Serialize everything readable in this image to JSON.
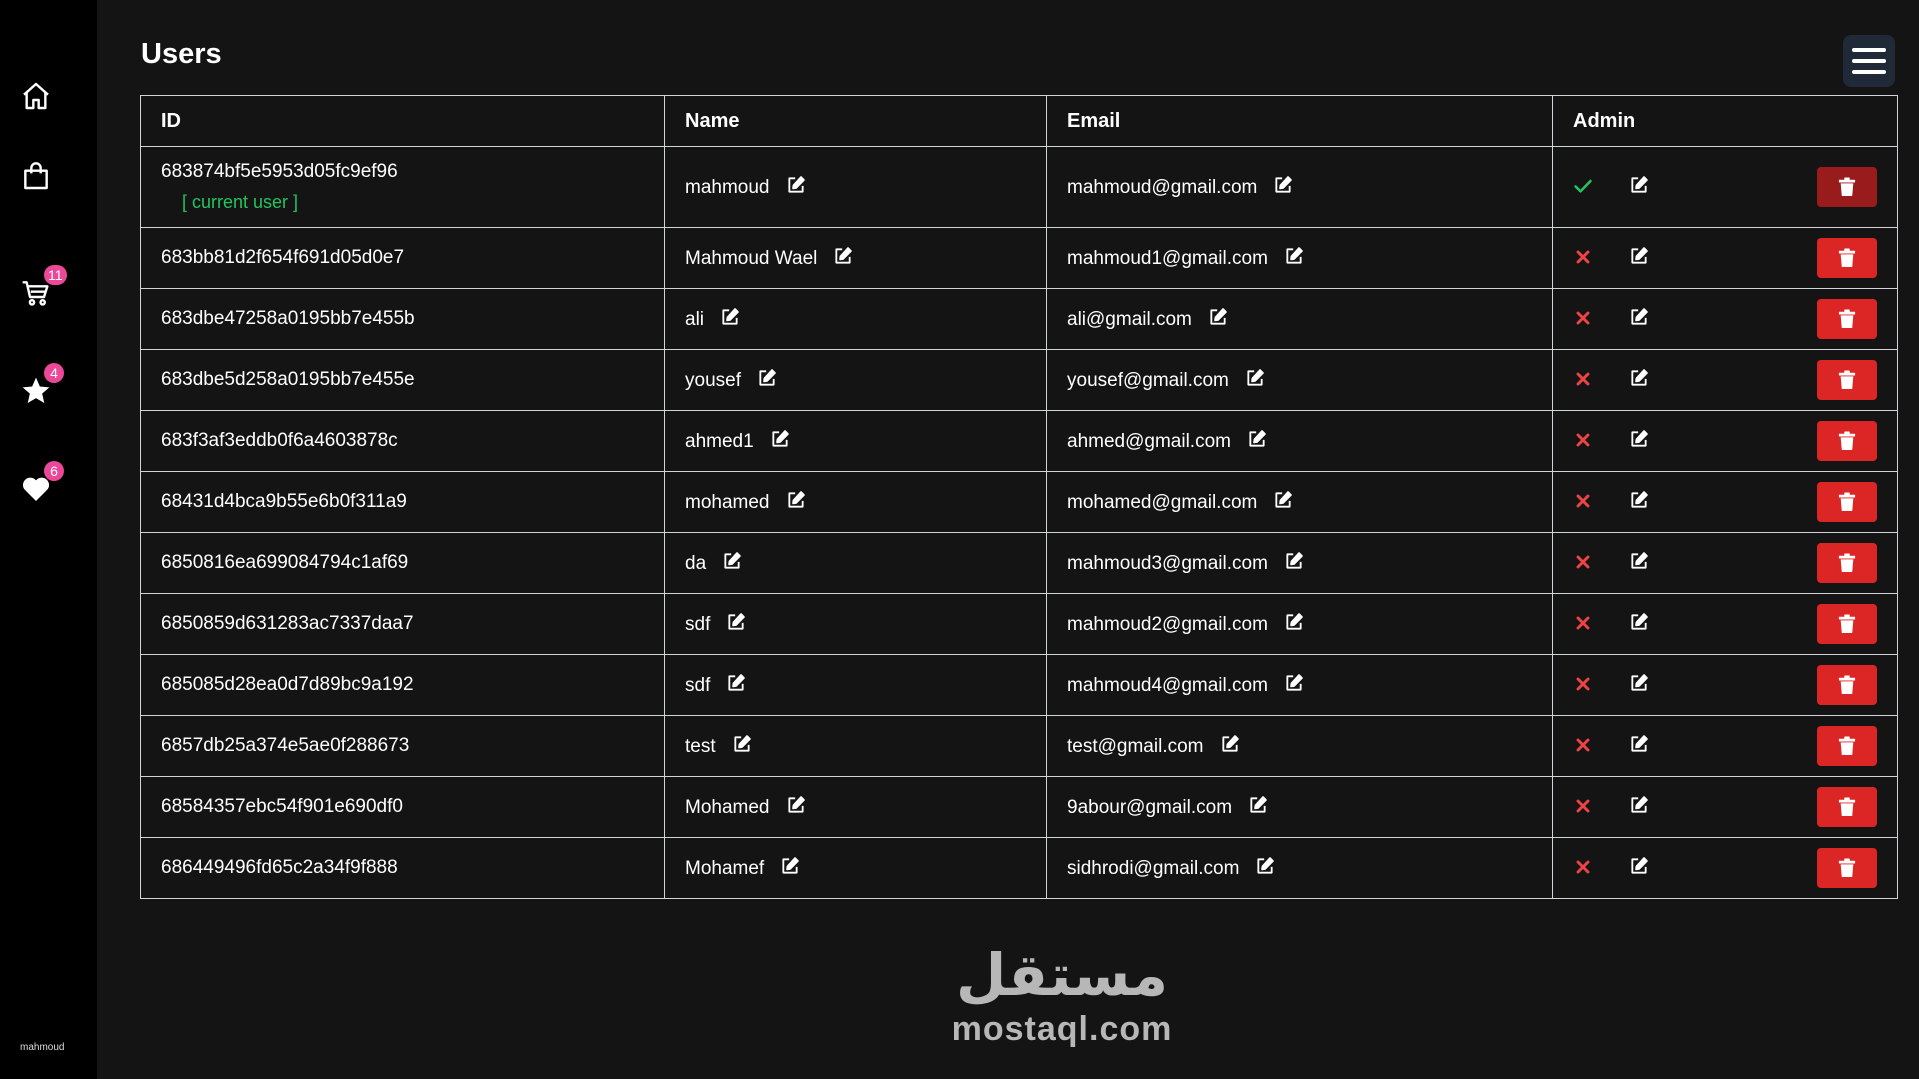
{
  "sidebar": {
    "items": [
      {
        "name": "home",
        "icon": "home-icon"
      },
      {
        "name": "shop",
        "icon": "shopping-bag-icon"
      },
      {
        "name": "cart",
        "icon": "cart-icon",
        "badge": "11"
      },
      {
        "name": "favorites",
        "icon": "star-icon",
        "badge": "4"
      },
      {
        "name": "wishlist",
        "icon": "heart-icon",
        "badge": "6"
      }
    ],
    "user_label": "mahmoud"
  },
  "header": {
    "title": "Users",
    "menu_icon": "hamburger-icon"
  },
  "table": {
    "headers": [
      "ID",
      "Name",
      "Email",
      "Admin"
    ],
    "current_user_label": "[ current user ]",
    "rows": [
      {
        "id": "683874bf5e5953d05fc9ef96",
        "name": "mahmoud",
        "email": "mahmoud@gmail.com",
        "admin": true,
        "current": true
      },
      {
        "id": "683bb81d2f654f691d05d0e7",
        "name": "Mahmoud Wael",
        "email": "mahmoud1@gmail.com",
        "admin": false
      },
      {
        "id": "683dbe47258a0195bb7e455b",
        "name": "ali",
        "email": "ali@gmail.com",
        "admin": false
      },
      {
        "id": "683dbe5d258a0195bb7e455e",
        "name": "yousef",
        "email": "yousef@gmail.com",
        "admin": false
      },
      {
        "id": "683f3af3eddb0f6a4603878c",
        "name": "ahmed1",
        "email": "ahmed@gmail.com",
        "admin": false
      },
      {
        "id": "68431d4bca9b55e6b0f311a9",
        "name": "mohamed",
        "email": "mohamed@gmail.com",
        "admin": false
      },
      {
        "id": "6850816ea699084794c1af69",
        "name": "da",
        "email": "mahmoud3@gmail.com",
        "admin": false
      },
      {
        "id": "6850859d631283ac7337daa7",
        "name": "sdf",
        "email": "mahmoud2@gmail.com",
        "admin": false
      },
      {
        "id": "685085d28ea0d7d89bc9a192",
        "name": "sdf",
        "email": "mahmoud4@gmail.com",
        "admin": false
      },
      {
        "id": "6857db25a374e5ae0f288673",
        "name": "test",
        "email": "test@gmail.com",
        "admin": false
      },
      {
        "id": "68584357ebc54f901e690df0",
        "name": "Mohamed",
        "email": "9abour@gmail.com",
        "admin": false
      },
      {
        "id": "686449496fd65c2a34f9f888",
        "name": "Mohamef",
        "email": "sidhrodi@gmail.com",
        "admin": false
      }
    ]
  },
  "colors": {
    "admin_yes": "#22c55e",
    "admin_no": "#ef4444",
    "delete": "#dc2626",
    "badge": "#ec4899"
  },
  "watermark": {
    "arabic": "مستقل",
    "latin": "mostaql.com"
  }
}
